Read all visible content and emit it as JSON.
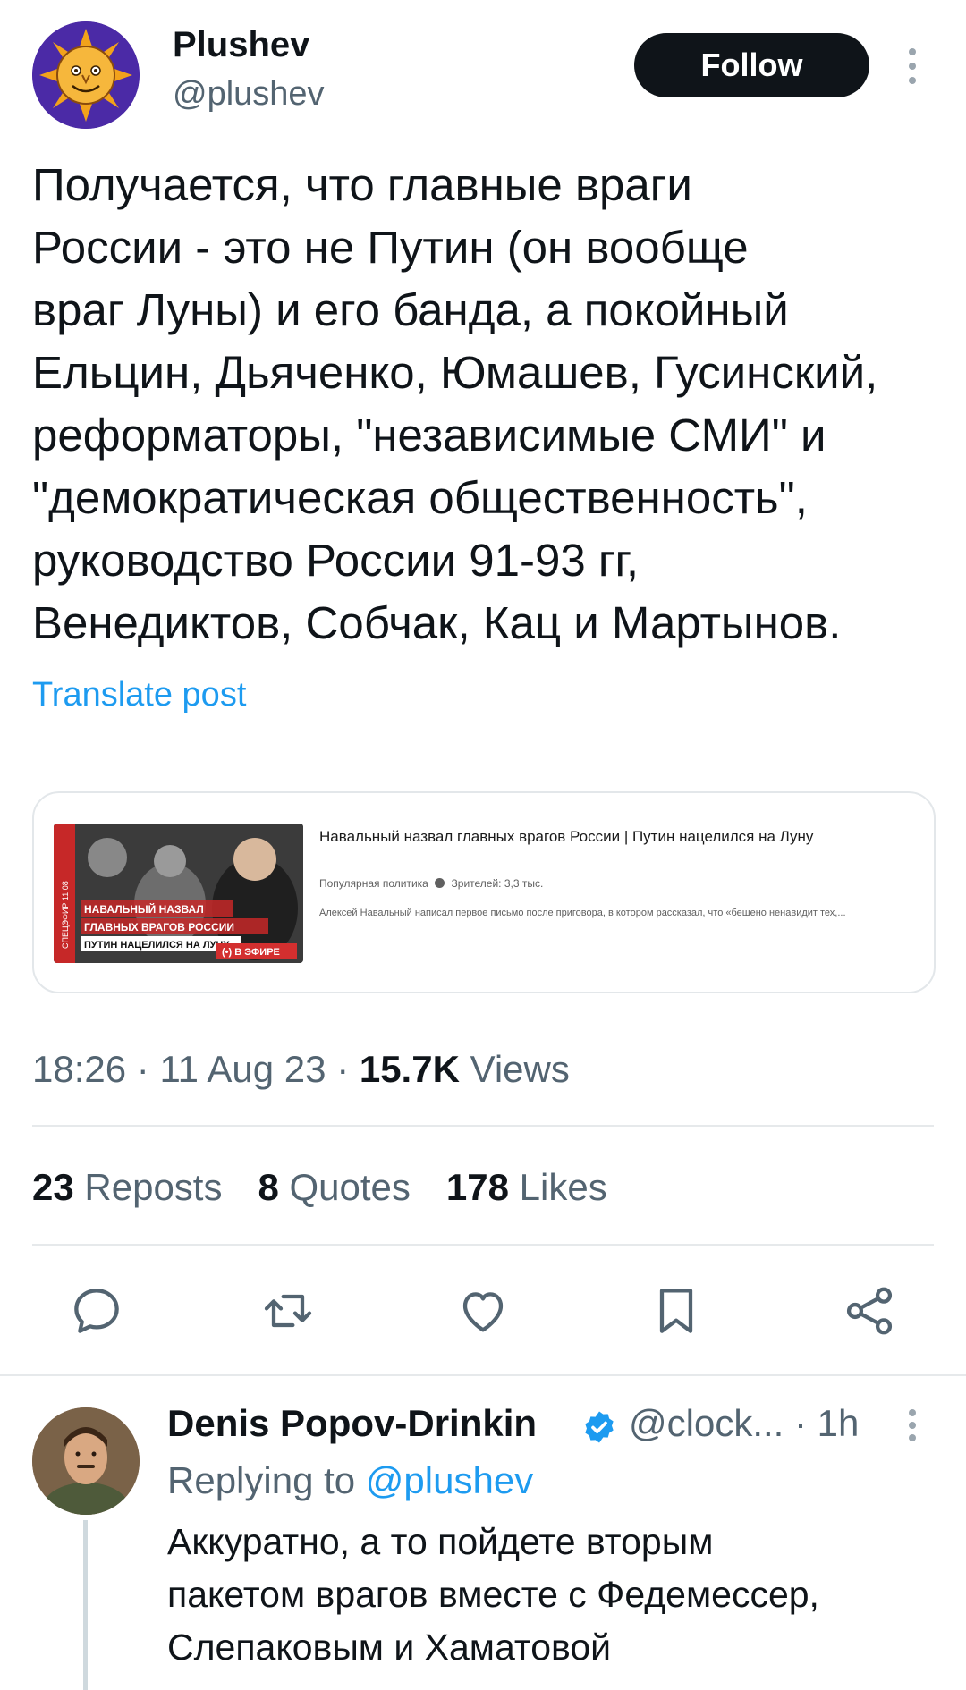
{
  "author": {
    "name": "Plushev",
    "handle": "@plushev",
    "follow_label": "Follow"
  },
  "post": {
    "text": "Получается, что главные враги\nРоссии - это не Путин (он вообще\nвраг Луны) и его банда, а покойный\nЕльцин, Дьяченко, Юмашев, Гусинский,\nреформаторы, \"независимые СМИ\" и\n\"демократическая общественность\",\nруководство России 91-93 гг,\nВенедиктов, Собчак, Кац и Мартынов.",
    "translate_label": "Translate post"
  },
  "link_card": {
    "title": "Навальный назвал главных врагов России | Путин нацелился на Луну",
    "channel": "Популярная политика",
    "viewers": "Зрителей: 3,3 тыс.",
    "description": "Алексей Навальный написал первое письмо после приговора, в котором рассказал, что «бешено ненавидит тех,...",
    "thumb_side_label": "СПЕЦЭФИР 11.08",
    "thumb_headline_1": "НАВАЛЬНЫЙ НАЗВАЛ",
    "thumb_headline_2": "ГЛАВНЫХ ВРАГОВ РОССИИ",
    "thumb_headline_3": "ПУТИН НАЦЕЛИЛСЯ НА ЛУНУ",
    "thumb_live": "(•) В ЭФИРЕ"
  },
  "meta": {
    "time": "18:26",
    "date": "11 Aug 23",
    "views_count": "15.7K",
    "views_label": "Views"
  },
  "stats": [
    {
      "count": "23",
      "label": "Reposts"
    },
    {
      "count": "8",
      "label": "Quotes"
    },
    {
      "count": "178",
      "label": "Likes"
    }
  ],
  "actions": [
    "reply-icon",
    "repost-icon",
    "like-icon",
    "bookmark-icon",
    "share-icon"
  ],
  "reply": {
    "name": "Denis Popov-Drinkin",
    "handle": "@clock...",
    "time": "· 1h",
    "replying_prefix": "Replying to",
    "replying_handle": "@plushev",
    "text": "Аккуратно, а то пойдете вторым\nпакетом врагов вместе с Федемессер,\nСлепаковым и Хаматовой"
  },
  "colors": {
    "accent": "#1d9bf0",
    "text": "#0f1419",
    "secondary": "#536471",
    "verified": "#1d9bf0"
  }
}
